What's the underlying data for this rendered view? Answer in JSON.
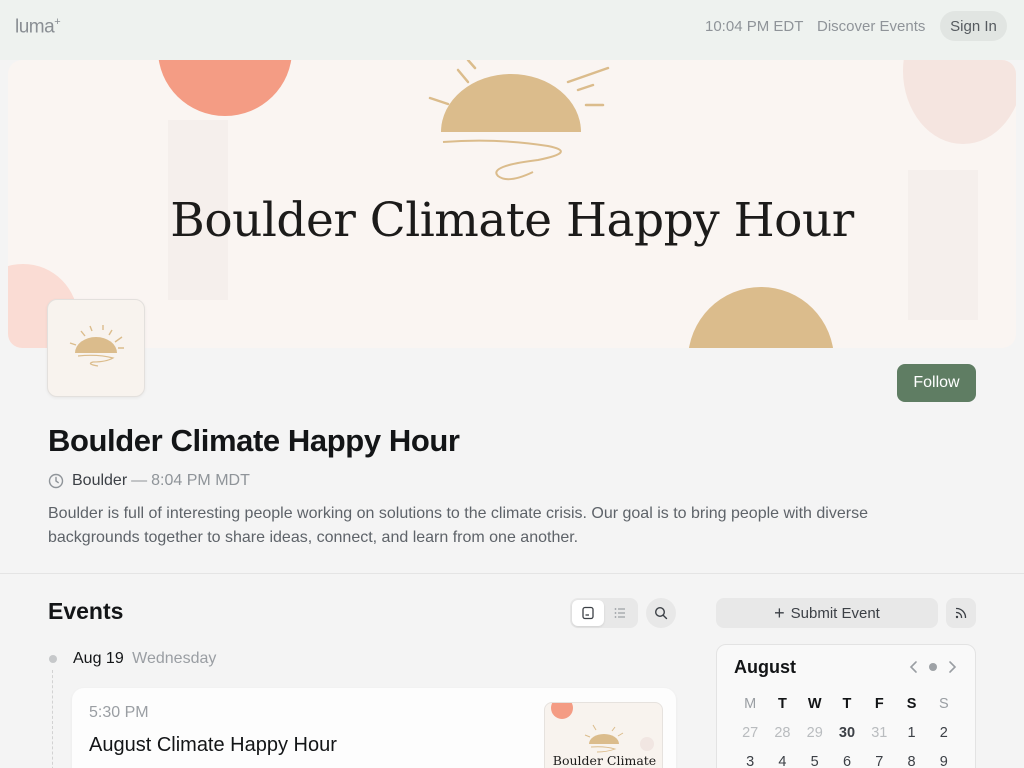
{
  "topbar": {
    "logo": "luma",
    "logo_mark": "+",
    "time": "10:04 PM EDT",
    "discover_label": "Discover Events",
    "signin_label": "Sign In"
  },
  "banner": {
    "title": "Boulder Climate Happy Hour"
  },
  "calendar_page": {
    "follow_label": "Follow",
    "title": "Boulder Climate Happy Hour",
    "location": "Boulder",
    "separator": "—",
    "local_time": "8:04 PM MDT",
    "description": "Boulder is full of interesting people working on solutions to the climate crisis. Our goal is to bring people with diverse backgrounds together to share ideas, connect, and learn from one another."
  },
  "events": {
    "heading": "Events",
    "submit_label": "Submit Event",
    "date": {
      "day": "Aug 19",
      "weekday": "Wednesday"
    },
    "items": [
      {
        "time": "5:30 PM",
        "title": "August Climate Happy Hour",
        "thumb_text": "Boulder Climate"
      }
    ]
  },
  "mini_calendar": {
    "month": "August",
    "weekdays": [
      "M",
      "T",
      "W",
      "T",
      "F",
      "S",
      "S"
    ],
    "rows": [
      [
        "27",
        "28",
        "29",
        "30",
        "31",
        "1",
        "2"
      ],
      [
        "3",
        "4",
        "5",
        "6",
        "7",
        "8",
        "9"
      ]
    ]
  },
  "colors": {
    "accent_green": "#5f7d63",
    "banner_coral": "#f49c84",
    "banner_sand": "#dbbc8c"
  }
}
